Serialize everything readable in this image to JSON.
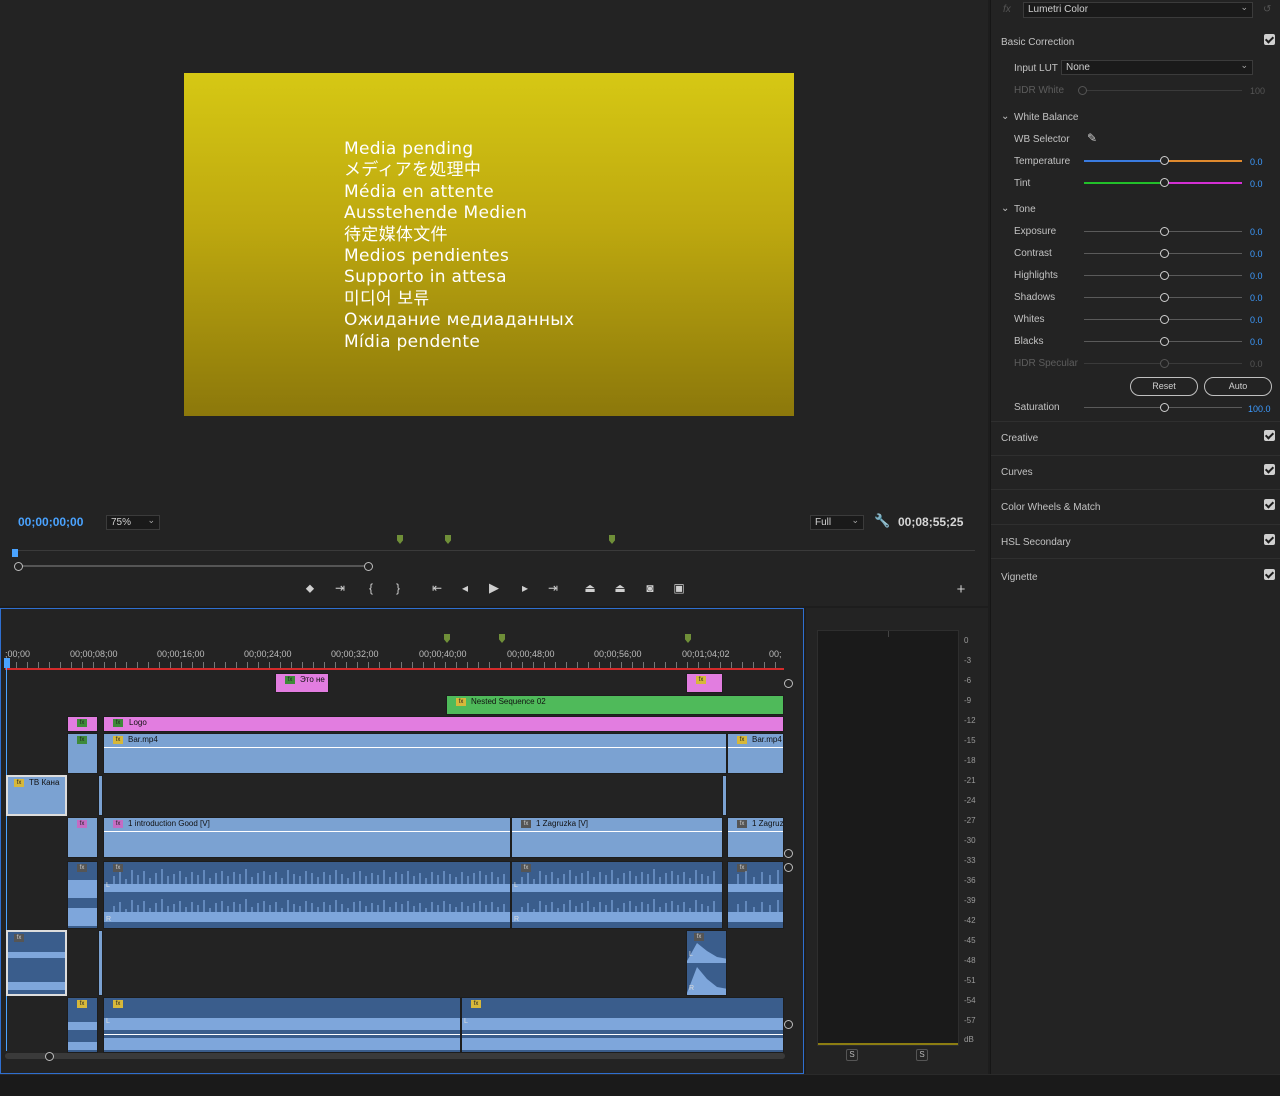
{
  "monitor": {
    "preview_lines": [
      "Media pending",
      "メディアを処理中",
      "Média en attente",
      "Ausstehende Medien",
      "待定媒体文件",
      "Medios pendientes",
      "Supporto in attesa",
      "미디어 보류",
      "Ожидание медиаданных",
      "Mídia pendente"
    ],
    "current_timecode": "00;00;00;00",
    "zoom_level": "75%",
    "resolution": "Full",
    "duration_timecode": "00;08;55;25",
    "colors": {
      "accent": "#4aa3ff",
      "preview_top": "#d6c814",
      "preview_bottom": "#8c780b"
    }
  },
  "lumetri": {
    "effect_name": "Lumetri Color",
    "fx_label": "fx",
    "basic_correction": "Basic Correction",
    "input_lut_label": "Input LUT",
    "input_lut_value": "None",
    "hdr_white_label": "HDR White",
    "hdr_white_value": "100",
    "white_balance": "White Balance",
    "wb_selector": "WB Selector",
    "temperature": {
      "label": "Temperature",
      "value": "0.0"
    },
    "tint": {
      "label": "Tint",
      "value": "0.0"
    },
    "tone": "Tone",
    "tone_sliders": [
      {
        "label": "Exposure",
        "value": "0.0"
      },
      {
        "label": "Contrast",
        "value": "0.0"
      },
      {
        "label": "Highlights",
        "value": "0.0"
      },
      {
        "label": "Shadows",
        "value": "0.0"
      },
      {
        "label": "Whites",
        "value": "0.0"
      },
      {
        "label": "Blacks",
        "value": "0.0"
      },
      {
        "label": "HDR Specular",
        "value": "0.0"
      }
    ],
    "reset_label": "Reset",
    "auto_label": "Auto",
    "saturation": {
      "label": "Saturation",
      "value": "100.0"
    },
    "sections": [
      "Creative",
      "Curves",
      "Color Wheels & Match",
      "HSL Secondary",
      "Vignette"
    ]
  },
  "timeline": {
    "ruler_labels": [
      ";00;00",
      "00;00;08;00",
      "00;00;16;00",
      "00;00;24;00",
      "00;00;32;00",
      "00;00;40;00",
      "00;00;48;00",
      "00;00;56;00",
      "00;01;04;02",
      "00;"
    ],
    "clips": {
      "eto_ne": "Это не",
      "nested": "Nested Sequence 02",
      "logo": "Logo",
      "bar1": "Bar.mp4",
      "bar2": "Bar.mp4",
      "tv_kana": "ТВ Кана",
      "intro": "1 introduction Good [V]",
      "zagruzka": "1 Zagruzka [V]",
      "zagruzka2": "1 Zagruz"
    },
    "channel_l": "L",
    "channel_r": "R",
    "fx_label": "fx"
  },
  "meter": {
    "db_scale": [
      "0",
      "-3",
      "-6",
      "-9",
      "-12",
      "-15",
      "-18",
      "-21",
      "-24",
      "-27",
      "-30",
      "-33",
      "-36",
      "-39",
      "-42",
      "-45",
      "-48",
      "-51",
      "-54",
      "-57",
      "dB"
    ],
    "solo_left": "S",
    "solo_right": "S"
  }
}
